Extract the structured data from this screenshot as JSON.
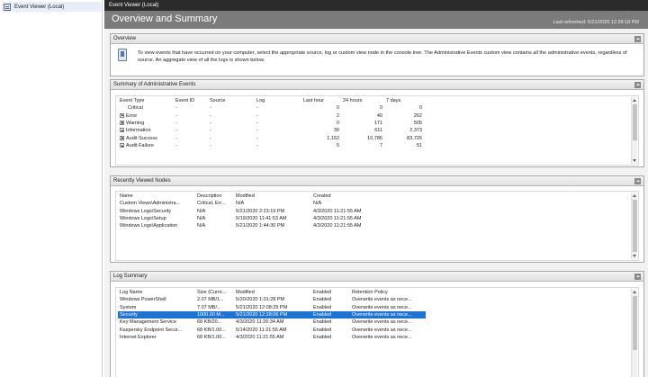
{
  "tree": {
    "root_label": "Event Viewer (Local)"
  },
  "titlebar": {
    "title": "Event Viewer (Local)"
  },
  "header": {
    "title": "Overview and Summary",
    "last_refreshed": "Last refreshed: 5/21/2020 12:28:18 PM"
  },
  "overview": {
    "heading": "Overview",
    "text": "To view events that have occurred on your computer, select the appropriate source, log or custom view node in the console tree. The Administrative Events custom view contains all the administrative events, regardless of source. An aggregate view of all the logs is shown below."
  },
  "summary": {
    "heading": "Summary of Administrative Events",
    "columns": [
      "Event Type",
      "Event ID",
      "Source",
      "Log",
      "Last hour",
      "24 hours",
      "7 days"
    ],
    "rows": [
      {
        "type": "Critical",
        "id": "-",
        "source": "-",
        "log": "-",
        "hour": "0",
        "day": "0",
        "week": "0",
        "expandable": false
      },
      {
        "type": "Error",
        "id": "-",
        "source": "-",
        "log": "-",
        "hour": "2",
        "day": "40",
        "week": "262",
        "expandable": true
      },
      {
        "type": "Warning",
        "id": "-",
        "source": "-",
        "log": "-",
        "hour": "0",
        "day": "171",
        "week": "505",
        "expandable": true
      },
      {
        "type": "Information",
        "id": "-",
        "source": "-",
        "log": "-",
        "hour": "39",
        "day": "611",
        "week": "2,373",
        "expandable": true
      },
      {
        "type": "Audit Success",
        "id": "-",
        "source": "-",
        "log": "-",
        "hour": "1,152",
        "day": "10,786",
        "week": "83,726",
        "expandable": true
      },
      {
        "type": "Audit Failure",
        "id": "-",
        "source": "-",
        "log": "-",
        "hour": "5",
        "day": "7",
        "week": "51",
        "expandable": true
      }
    ]
  },
  "recent": {
    "heading": "Recently Viewed Nodes",
    "columns": [
      "Name",
      "Description",
      "Modified",
      "Created"
    ],
    "rows": [
      {
        "name": "Custom Views\\Administra...",
        "desc": "Critical, Err...",
        "modified": "N/A",
        "created": "N/A"
      },
      {
        "name": "Windows Logs\\Security",
        "desc": "N/A",
        "modified": "5/21/2020 2:23:19 PM",
        "created": "4/3/2020 11:21:55 AM"
      },
      {
        "name": "Windows Logs\\Setup",
        "desc": "N/A",
        "modified": "5/19/2020 11:41:53 AM",
        "created": "4/3/2020 11:21:55 AM"
      },
      {
        "name": "Windows Logs\\Application",
        "desc": "N/A",
        "modified": "5/21/2020 1:44:30 PM",
        "created": "4/3/2020 11:21:55 AM"
      }
    ]
  },
  "logsummary": {
    "heading": "Log Summary",
    "columns": [
      "Log Name",
      "Size (Curre...",
      "Modified",
      "Enabled",
      "Retention Policy"
    ],
    "rows": [
      {
        "name": "Windows PowerShell",
        "size": "2.07 MB/1...",
        "modified": "5/20/2020 1:01:28 PM",
        "enabled": "Enabled",
        "policy": "Overwrite events as nece...",
        "selected": false
      },
      {
        "name": "System",
        "size": "7.07 MB/...",
        "modified": "5/21/2020 12:08:29 PM",
        "enabled": "Enabled",
        "policy": "Overwrite events as nece...",
        "selected": false
      },
      {
        "name": "Security",
        "size": "1000.00 M...",
        "modified": "5/21/2020 12:28:06 PM",
        "enabled": "Enabled",
        "policy": "Overwrite events as nece...",
        "selected": true
      },
      {
        "name": "Key Management Service",
        "size": "68 KB/20...",
        "modified": "4/3/2020 11:26:34 AM",
        "enabled": "Enabled",
        "policy": "Overwrite events as nece...",
        "selected": false
      },
      {
        "name": "Kaspersky Endpoint Secur...",
        "size": "68 KB/1.00...",
        "modified": "5/14/2020 11:21:55 AM",
        "enabled": "Enabled",
        "policy": "Overwrite events as nece...",
        "selected": false
      },
      {
        "name": "Internet Explorer",
        "size": "68 KB/1.00...",
        "modified": "4/3/2020 11:21:55 AM",
        "enabled": "Enabled",
        "policy": "Overwrite events as nece...",
        "selected": false
      }
    ]
  }
}
